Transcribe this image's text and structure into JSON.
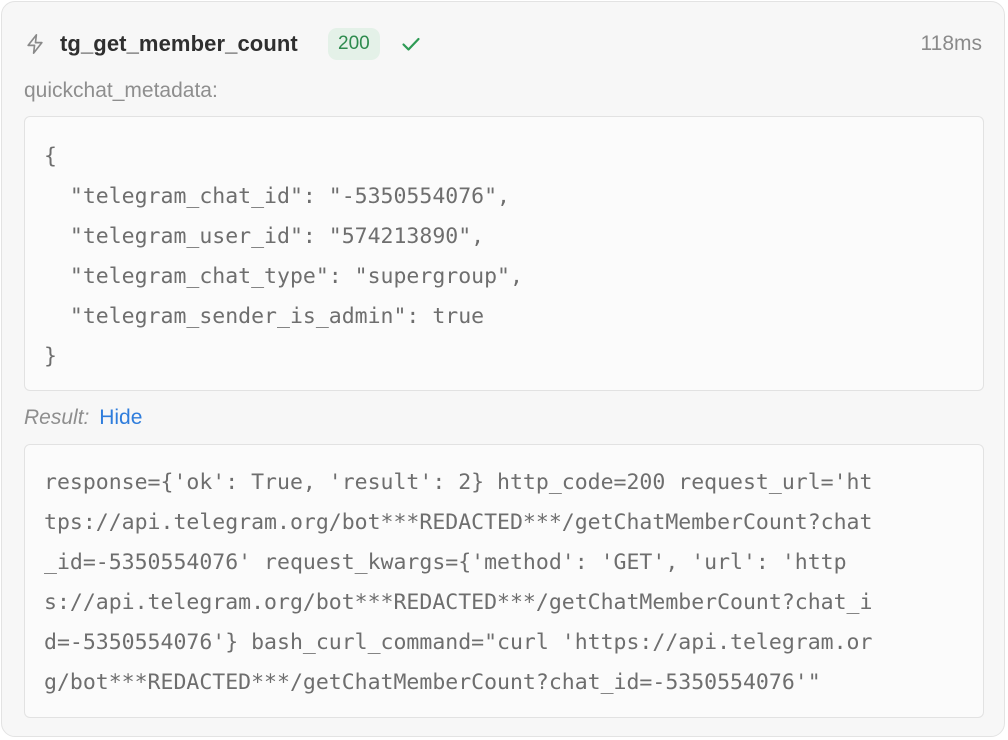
{
  "header": {
    "tool_name": "tg_get_member_count",
    "status_code": "200",
    "duration": "118ms",
    "icon": "lightning-bolt-icon",
    "status_icon": "checkmark-icon",
    "colors": {
      "badge_bg": "#e4f1e8",
      "badge_text": "#2e8b4e",
      "link": "#2f7ddc"
    }
  },
  "metadata": {
    "label": "quickchat_metadata:",
    "lines": [
      "{",
      "  \"telegram_chat_id\": \"-5350554076\",",
      "  \"telegram_user_id\": \"574213890\",",
      "  \"telegram_chat_type\": \"supergroup\",",
      "  \"telegram_sender_is_admin\": true",
      "}"
    ]
  },
  "result": {
    "label": "Result:",
    "toggle_label": "Hide",
    "lines": [
      "response={'ok': True, 'result': 2} http_code=200 request_url='ht",
      "tps://api.telegram.org/bot***REDACTED***/getChatMemberCount?chat",
      "_id=-5350554076' request_kwargs={'method': 'GET', 'url': 'http",
      "s://api.telegram.org/bot***REDACTED***/getChatMemberCount?chat_i",
      "d=-5350554076'} bash_curl_command=\"curl 'https://api.telegram.or",
      "g/bot***REDACTED***/getChatMemberCount?chat_id=-5350554076'\""
    ]
  }
}
